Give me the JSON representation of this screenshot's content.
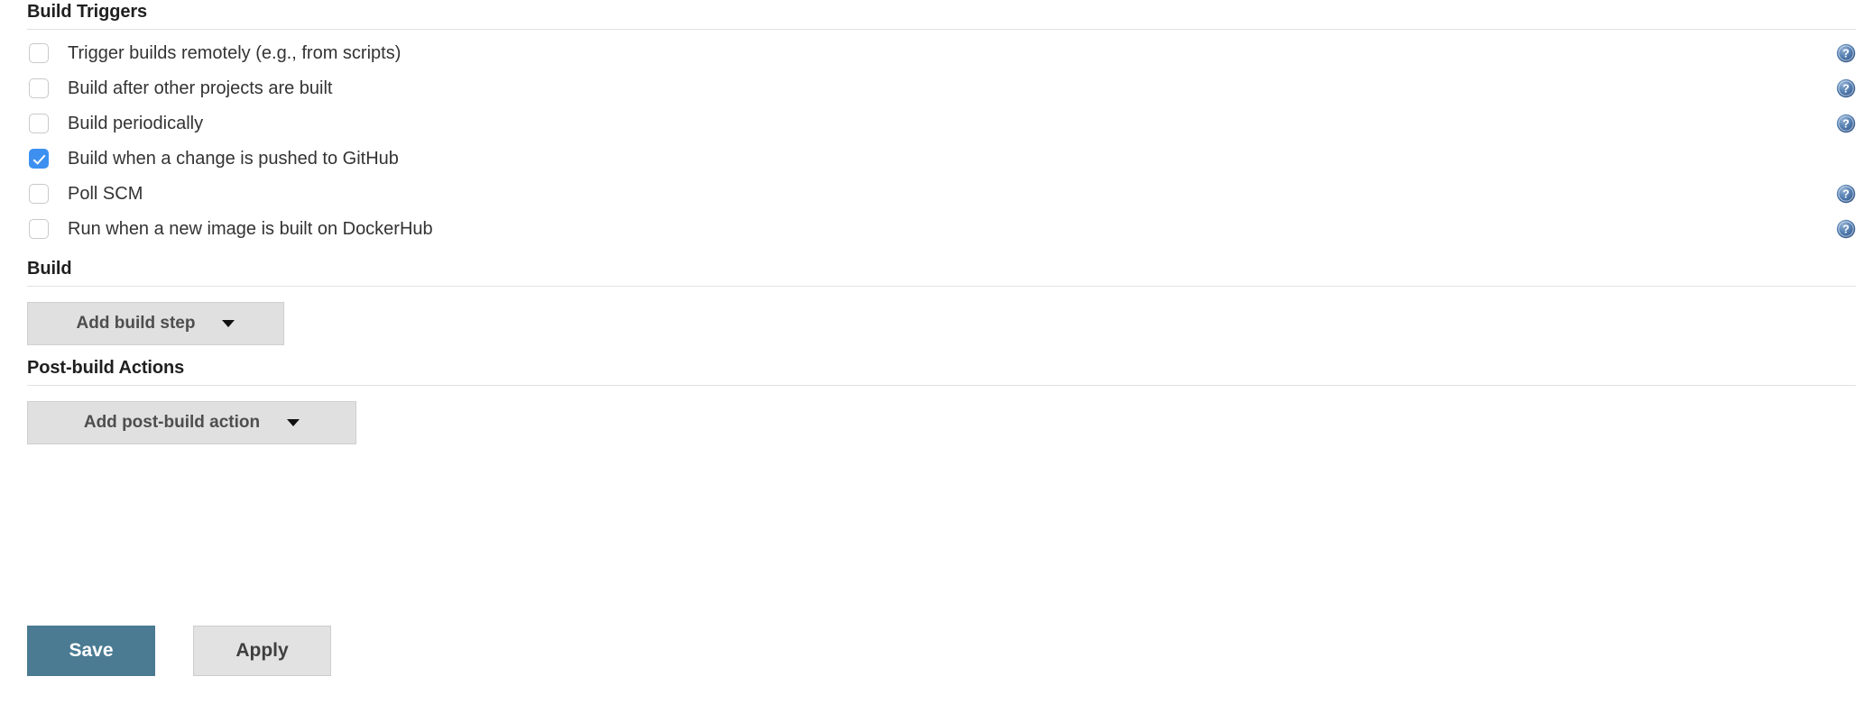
{
  "sections": {
    "build_triggers": {
      "heading": "Build Triggers",
      "triggers": [
        {
          "label": "Trigger builds remotely (e.g., from scripts)",
          "checked": false,
          "help": true,
          "help_icon": "help-icon"
        },
        {
          "label": "Build after other projects are built",
          "checked": false,
          "help": true,
          "help_icon": "help-icon"
        },
        {
          "label": "Build periodically",
          "checked": false,
          "help": true,
          "help_icon": "help-icon"
        },
        {
          "label": "Build when a change is pushed to GitHub",
          "checked": true,
          "help": false,
          "help_icon": ""
        },
        {
          "label": "Poll SCM",
          "checked": false,
          "help": true,
          "help_icon": "help-icon"
        },
        {
          "label": "Run when a new image is built on DockerHub",
          "checked": false,
          "help": true,
          "help_icon": "help-icon"
        }
      ]
    },
    "build": {
      "heading": "Build",
      "add_button_label": "Add build step",
      "caret_icon": "chevron-down-icon"
    },
    "post_build_actions": {
      "heading": "Post-build Actions",
      "add_button_label": "Add post-build action",
      "caret_icon": "chevron-down-icon"
    }
  },
  "form_actions": {
    "save_label": "Save",
    "apply_label": "Apply"
  },
  "colors": {
    "checkbox_checked": "#3d90f0",
    "save_button": "#4a7b92",
    "apply_button": "#e2e2e2",
    "dropdown_button": "#e0e0e0",
    "divider": "#e2e2e2",
    "help_icon": "#3f6ea5"
  }
}
